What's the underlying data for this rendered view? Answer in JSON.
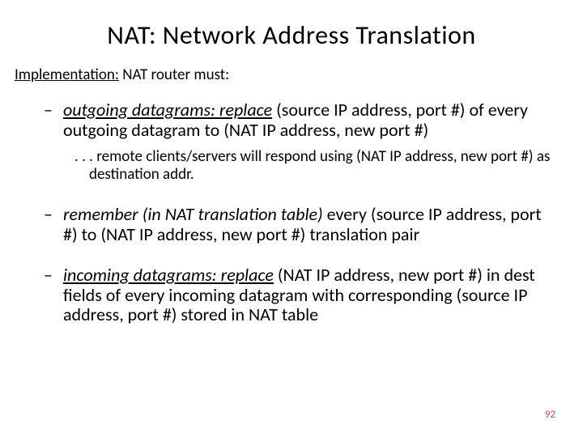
{
  "title": "NAT: Network Address Translation",
  "implementation_label_underlined": "Implementation:",
  "implementation_label_rest": " NAT router must:",
  "bullets": [
    {
      "lead": "outgoing datagrams: replace",
      "rest": " (source IP address, port #) of every outgoing datagram to (NAT IP address, new port #)",
      "sub": ". . . remote clients/servers will respond using (NAT IP address, new port #) as destination addr."
    },
    {
      "lead": "remember (in NAT translation table)",
      "rest": " every (source IP address, port #)  to (NAT IP address, new port #) translation pair",
      "sub": null
    },
    {
      "lead": "incoming datagrams: replace",
      "rest": " (NAT IP address, new port #) in dest fields of every incoming datagram with corresponding (source IP address, port #) stored in NAT table",
      "sub": null
    }
  ],
  "page_number": "92"
}
